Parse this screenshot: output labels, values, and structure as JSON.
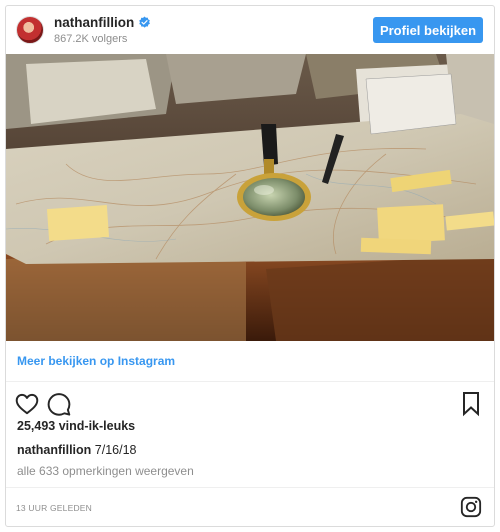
{
  "header": {
    "username": "nathanfillion",
    "followers": "867.2K volgers",
    "view_profile_label": "Profiel bekijken"
  },
  "post": {
    "image_alt": "Table covered with maps, notes, a magnifying glass and pens",
    "view_more_label": "Meer bekijken op Instagram",
    "likes": "25,493 vind-ik-leuks",
    "caption_user": "nathanfillion",
    "caption_text": "7/16/18",
    "comments_link": "alle 633 opmerkingen weergeven",
    "timestamp": "13 UUR GELEDEN"
  },
  "colors": {
    "accent": "#3897f0",
    "text": "#262626",
    "muted": "#8e8e8e"
  },
  "icons": {
    "verified": "verified-badge-icon",
    "like": "heart-icon",
    "comment": "comment-icon",
    "save": "bookmark-icon",
    "brand": "instagram-icon"
  }
}
